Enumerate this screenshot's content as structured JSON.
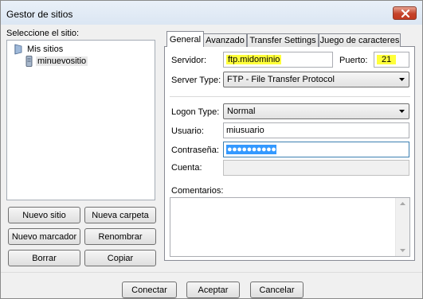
{
  "window": {
    "title": "Gestor de sitios"
  },
  "site_panel": {
    "label": "Seleccione el sitio:",
    "tree": {
      "root": "Mis sitios",
      "child": "minuevositio"
    }
  },
  "site_buttons": {
    "new_site": "Nuevo sitio",
    "new_folder": "Nueva carpeta",
    "new_bookmark": "Nuevo marcador",
    "rename": "Renombrar",
    "delete": "Borrar",
    "copy": "Copiar"
  },
  "tabs": [
    "General",
    "Avanzado",
    "Transfer Settings",
    "Juego de caracteres"
  ],
  "active_tab": "General",
  "general": {
    "server_label": "Servidor:",
    "server_value": "ftp.midominio",
    "port_label": "Puerto:",
    "port_value": "21",
    "server_type_label": "Server Type:",
    "server_type_value": "FTP - File Transfer Protocol",
    "logon_type_label": "Logon Type:",
    "logon_type_value": "Normal",
    "user_label": "Usuario:",
    "user_value": "miusuario",
    "password_label": "Contraseña:",
    "password_value": "●●●●●●●●●●",
    "account_label": "Cuenta:",
    "account_value": "",
    "comments_label": "Comentarios:",
    "comments_value": ""
  },
  "footer": {
    "connect": "Conectar",
    "accept": "Aceptar",
    "cancel": "Cancelar"
  },
  "colors": {
    "highlight": "#ffff3a",
    "selection": "#3399ff",
    "close_button": "#c5432b"
  }
}
